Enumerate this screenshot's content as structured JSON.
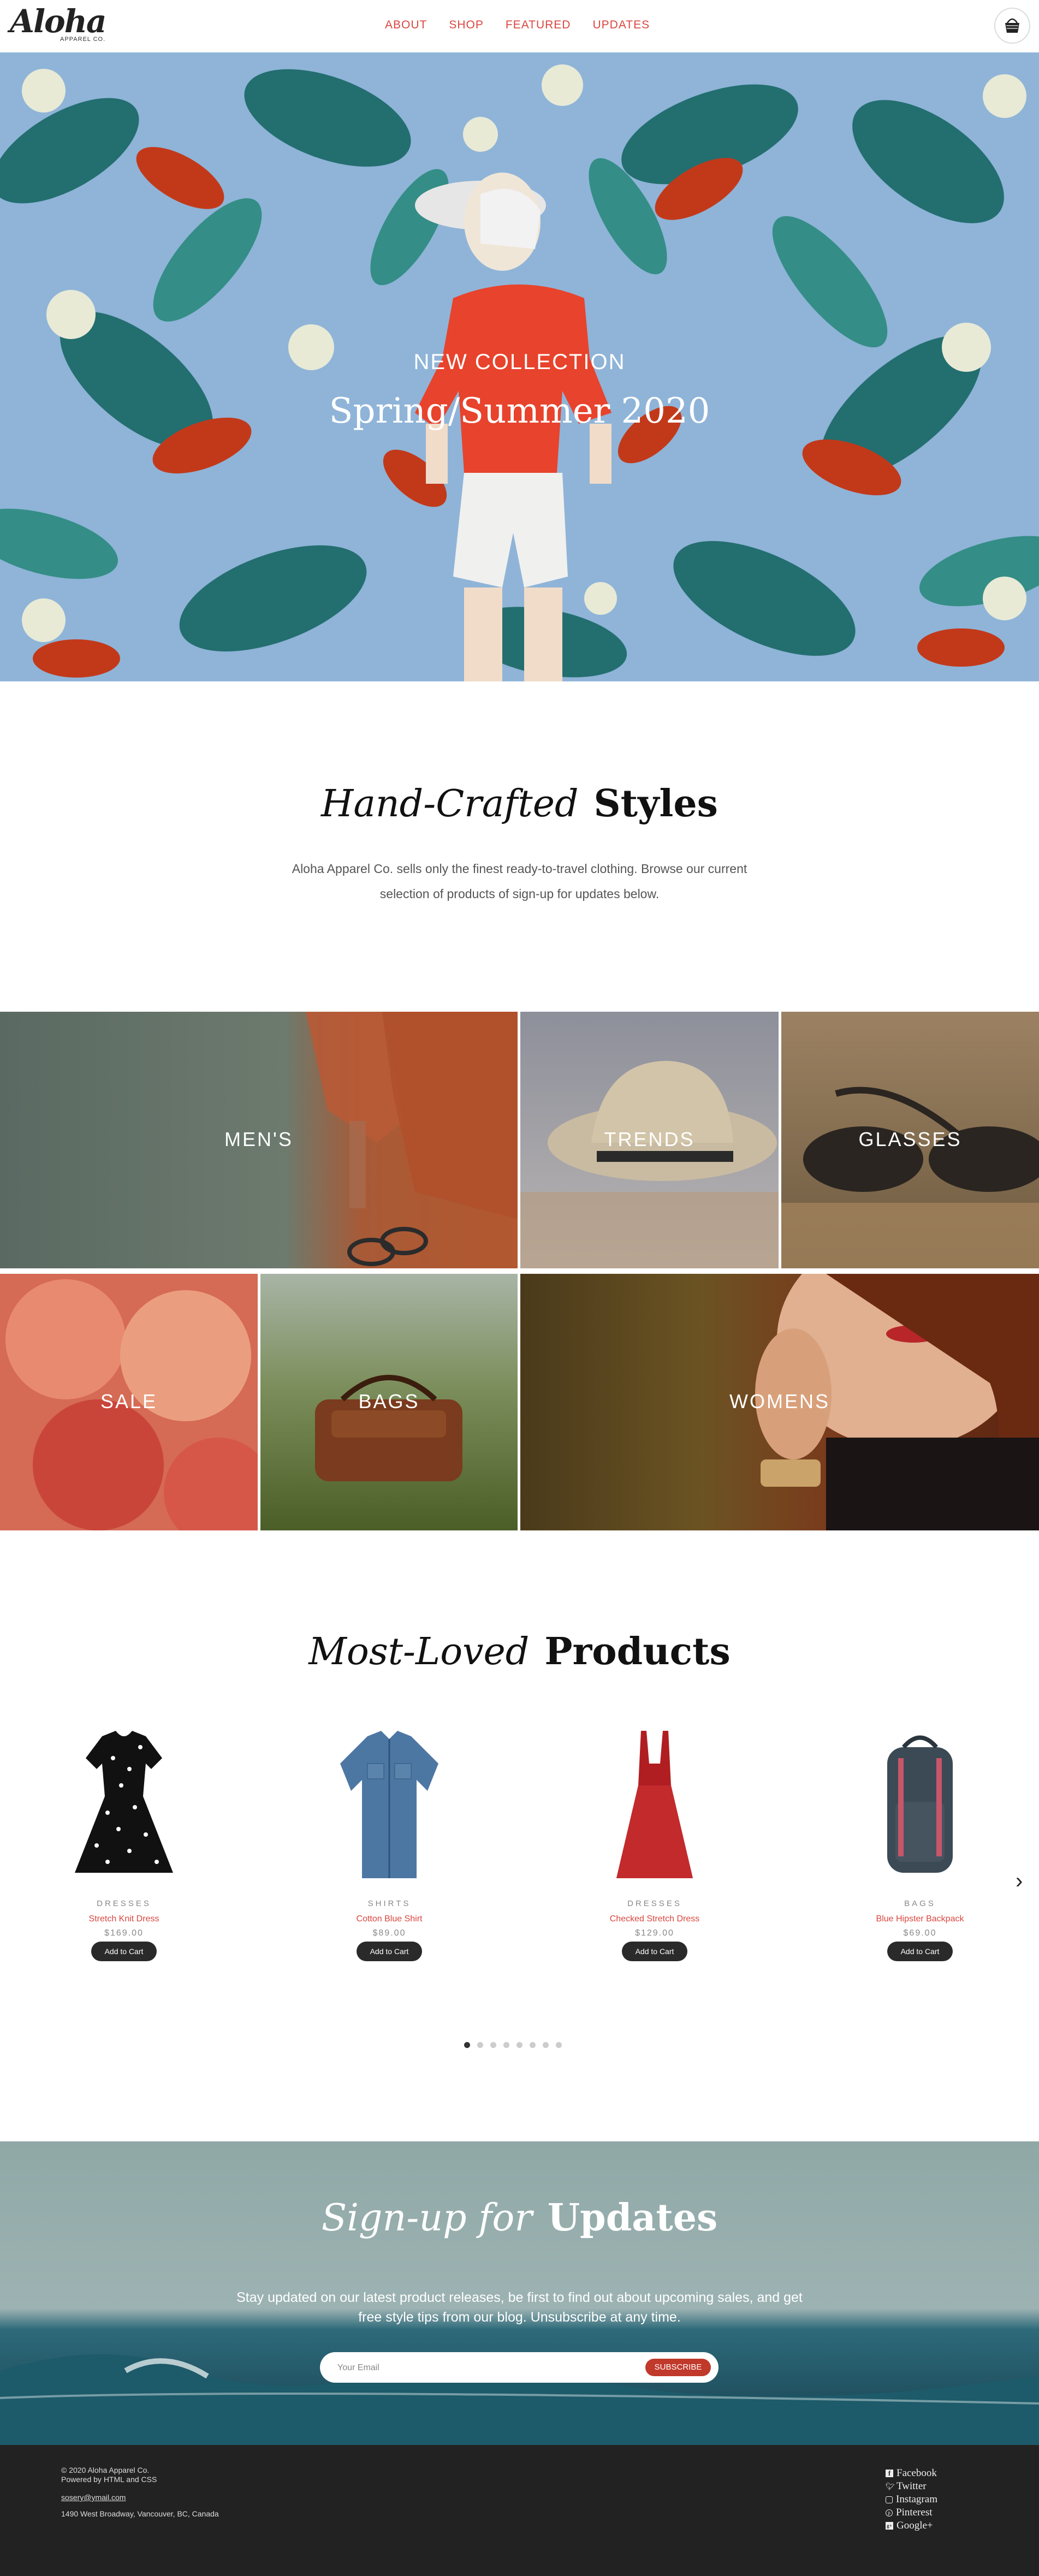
{
  "header": {
    "logo_text": "Aloha",
    "logo_sub": "APPAREL CO.",
    "nav": [
      {
        "label": "ABOUT"
      },
      {
        "label": "SHOP"
      },
      {
        "label": "FEATURED"
      },
      {
        "label": "UPDATES"
      }
    ],
    "cart_icon": "basket-icon"
  },
  "hero": {
    "subtitle": "NEW COLLECTION",
    "title": "Spring/Summer 2020"
  },
  "intro": {
    "title_italic": "Hand-Crafted",
    "title_bold": "Styles",
    "text": "Aloha Apparel Co. sells only the finest ready-to-travel clothing. Browse our current selection of products of sign-up for updates below."
  },
  "categories": [
    {
      "label": "MEN'S"
    },
    {
      "label": "TRENDS"
    },
    {
      "label": "GLASSES"
    },
    {
      "label": "SALE"
    },
    {
      "label": "BAGS"
    },
    {
      "label": "WOMENS"
    }
  ],
  "products_section": {
    "title_italic": "Most-Loved",
    "title_bold": "Products",
    "items": [
      {
        "category": "DRESSES",
        "name": "Stretch Knit Dress",
        "price": "$169.00",
        "button": "Add to Cart"
      },
      {
        "category": "SHIRTS",
        "name": "Cotton Blue Shirt",
        "price": "$89.00",
        "button": "Add to Cart"
      },
      {
        "category": "DRESSES",
        "name": "Checked Stretch Dress",
        "price": "$129.00",
        "button": "Add to Cart"
      },
      {
        "category": "BAGS",
        "name": "Blue Hipster Backpack",
        "price": "$69.00",
        "button": "Add to Cart"
      }
    ],
    "next_arrow": "›",
    "dots_count": 8,
    "active_dot": 1
  },
  "signup": {
    "title_italic": "Sign-up for",
    "title_bold": "Updates",
    "text": "Stay updated on our latest product releases, be first to find out about upcoming sales, and get free style tips from our blog. Unsubscribe at any time.",
    "email_placeholder": "Your Email",
    "button": "SUBSCRIBE"
  },
  "footer": {
    "copyright": "© 2020 Aloha Apparel Co.",
    "powered": "Powered by HTML and CSS",
    "email": "sosery@ymail.com",
    "address": "1490 West Broadway, Vancouver, BC, Canada",
    "social": [
      {
        "icon": "facebook-icon",
        "label": "Facebook"
      },
      {
        "icon": "twitter-icon",
        "label": "Twitter"
      },
      {
        "icon": "instagram-icon",
        "label": "Instagram"
      },
      {
        "icon": "pinterest-icon",
        "label": "Pinterest"
      },
      {
        "icon": "google-plus-icon",
        "label": "Google+"
      }
    ]
  },
  "colors": {
    "accent": "#d9463f",
    "button_dark": "#2a2a2a",
    "subscribe": "#c0392b",
    "footer_bg": "#222222"
  }
}
